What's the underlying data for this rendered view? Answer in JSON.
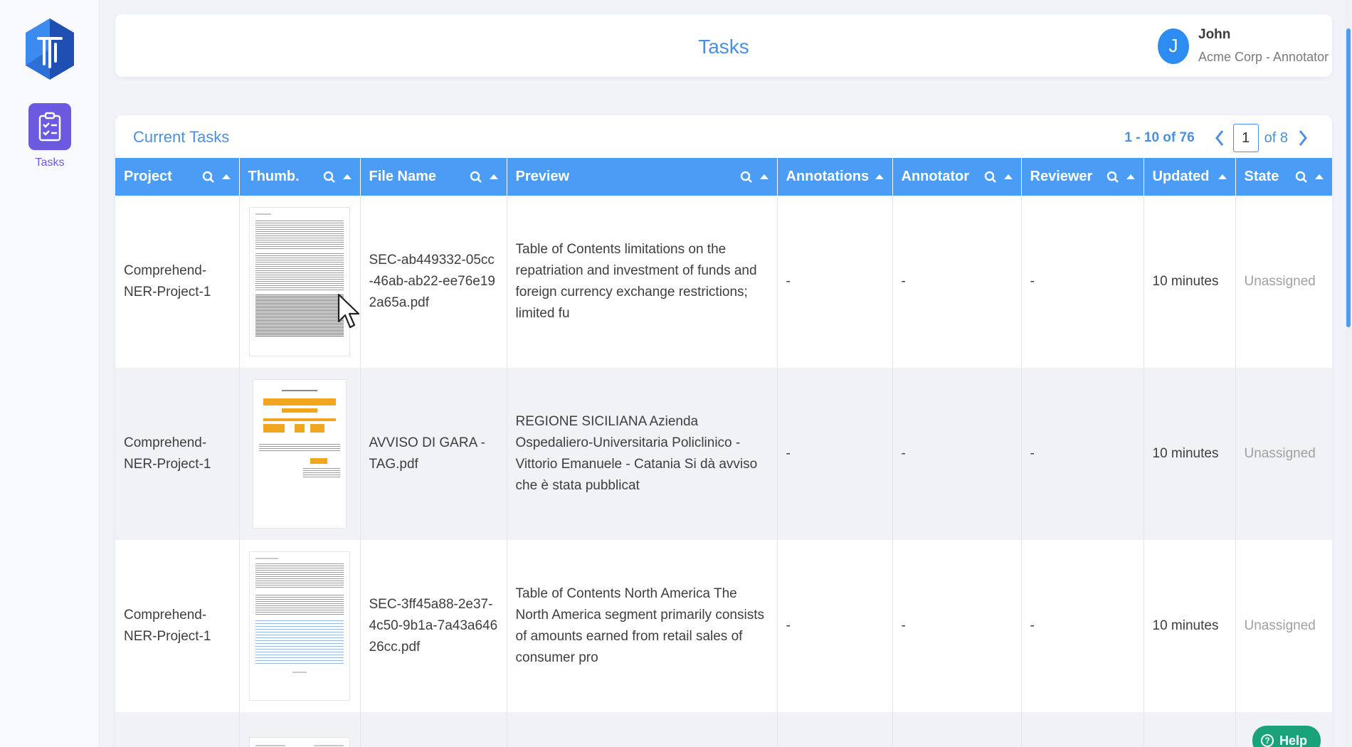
{
  "sidebar": {
    "logo_icon": "hexagon-logo-icon",
    "items": [
      {
        "label": "Tasks",
        "icon": "clipboard-checklist-icon",
        "active": true
      }
    ]
  },
  "header": {
    "title": "Tasks",
    "user": {
      "initial": "J",
      "name": "John",
      "org": "Acme Corp - Annotator"
    }
  },
  "panel": {
    "title": "Current Tasks",
    "pager": {
      "range": "1 - 10 of 76",
      "page": "1",
      "of": "of 8"
    }
  },
  "table": {
    "columns": [
      {
        "label": "Project"
      },
      {
        "label": "Thumb."
      },
      {
        "label": "File Name"
      },
      {
        "label": "Preview"
      },
      {
        "label": "Annotations"
      },
      {
        "label": "Annotator"
      },
      {
        "label": "Reviewer"
      },
      {
        "label": "Updated"
      },
      {
        "label": "State"
      }
    ],
    "rows": [
      {
        "project": "Comprehend-NER-Project-1",
        "file_name": "SEC-ab449332-05cc-46ab-ab22-ee76e192a65a.pdf",
        "preview": "Table of Contents limitations on the repatriation and investment of funds and foreign currency exchange restrictions; limited fu",
        "annotations": "-",
        "annotator": "-",
        "reviewer": "-",
        "updated": "10 minutes",
        "state": "Unassigned"
      },
      {
        "project": "Comprehend-NER-Project-1",
        "file_name": "AVVISO DI GARA - TAG.pdf",
        "preview": "REGIONE SICILIANA Azienda Ospedaliero-Universitaria Policlinico - Vittorio Emanuele - Catania Si dà avviso che è stata pubblicat",
        "annotations": "-",
        "annotator": "-",
        "reviewer": "-",
        "updated": "10 minutes",
        "state": "Unassigned"
      },
      {
        "project": "Comprehend-NER-Project-1",
        "file_name": "SEC-3ff45a88-2e37-4c50-9b1a-7a43a64626cc.pdf",
        "preview": "Table of Contents North America The North America segment primarily consists of amounts earned from retail sales of consumer pro",
        "annotations": "-",
        "annotator": "-",
        "reviewer": "-",
        "updated": "10 minutes",
        "state": "Unassigned"
      }
    ]
  },
  "help": {
    "label": "Help"
  },
  "colors": {
    "accent": "#4a9cf5",
    "nav_active": "#6b5ae0",
    "help": "#1aa37a"
  }
}
